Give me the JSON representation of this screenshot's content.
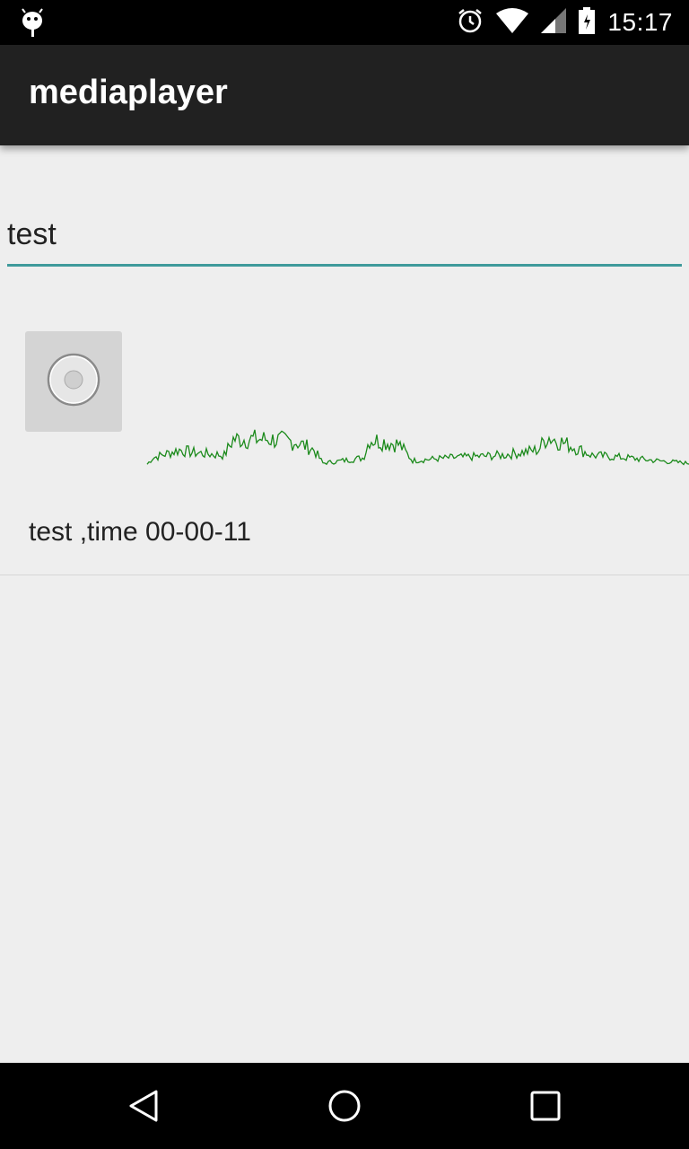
{
  "status_bar": {
    "time": "15:17",
    "icons": [
      "android-debug-icon",
      "alarm-icon",
      "wifi-icon",
      "signal-icon",
      "battery-icon"
    ]
  },
  "app_bar": {
    "title": "mediaplayer"
  },
  "search": {
    "value": "test"
  },
  "recordings": [
    {
      "label": "test ,time 00-00-11",
      "button_icon": "play-icon",
      "waveform_color": "#1b8a1b"
    }
  ],
  "nav_bar": {
    "icons": [
      "back-icon",
      "home-icon",
      "recents-icon"
    ]
  },
  "colors": {
    "accent": "#3f9a9b",
    "app_bar": "#212121",
    "background": "#eeeeee",
    "waveform": "#1b8a1b"
  }
}
